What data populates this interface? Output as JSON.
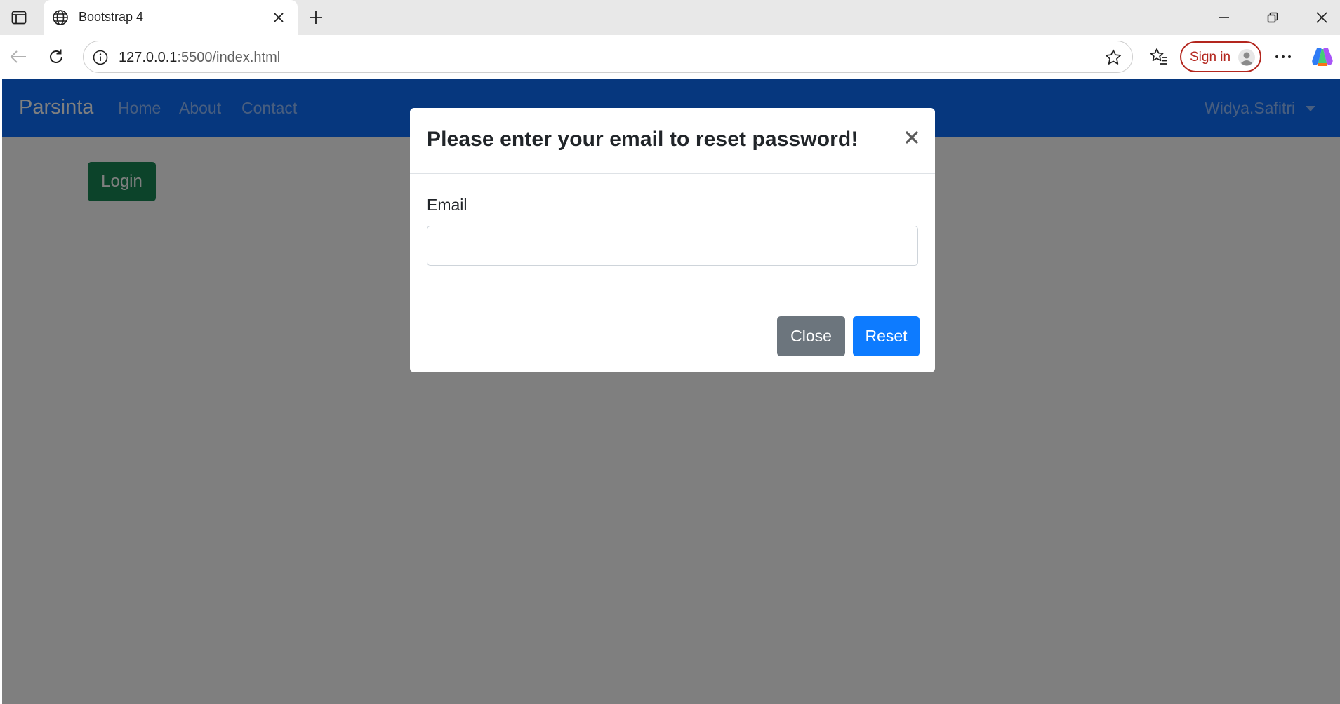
{
  "browser": {
    "tab": {
      "title": "Bootstrap 4"
    },
    "address": {
      "host": "127.0.0.1",
      "rest": ":5500/index.html"
    },
    "signin_label": "Sign in"
  },
  "navbar": {
    "brand": "Parsinta",
    "links": [
      "Home",
      "About",
      "Contact"
    ],
    "user": "Widya.Safitri"
  },
  "page": {
    "login_label": "Login"
  },
  "modal": {
    "title": "Please enter your email to reset password!",
    "email_label": "Email",
    "email_value": "",
    "close_label": "Close",
    "reset_label": "Reset"
  },
  "colors": {
    "navbar": "#0d6efd",
    "login": "#198754",
    "close_button": "#6c757d",
    "reset_button": "#0d7bff",
    "signin_accent": "#b3261e"
  }
}
